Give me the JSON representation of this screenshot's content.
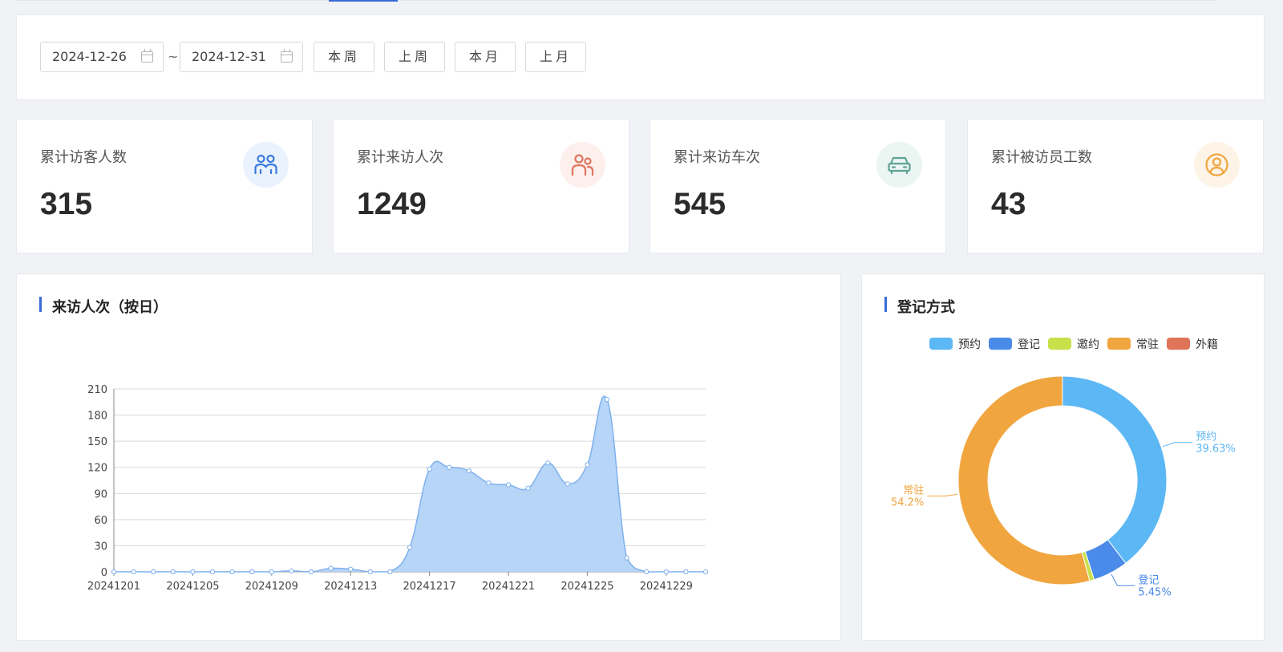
{
  "filter": {
    "start_date": "2024-12-26",
    "end_date": "2024-12-31",
    "separator": "~",
    "buttons": [
      "本周",
      "上周",
      "本月",
      "上月"
    ]
  },
  "stats": [
    {
      "label": "累计访客人数",
      "value": "315",
      "icon": "visitors-icon",
      "color": "#3a7bdc",
      "bg": "#eaf2fd"
    },
    {
      "label": "累计来访人次",
      "value": "1249",
      "icon": "users-icon",
      "color": "#e0745e",
      "bg": "#fcefec"
    },
    {
      "label": "累计来访车次",
      "value": "545",
      "icon": "car-icon",
      "color": "#5fa394",
      "bg": "#ebf5f2"
    },
    {
      "label": "累计被访员工数",
      "value": "43",
      "icon": "person-circle-icon",
      "color": "#f0a53e",
      "bg": "#fdf4e7"
    }
  ],
  "line_panel": {
    "title": "来访人次（按日）"
  },
  "pie_panel": {
    "title": "登记方式"
  },
  "chart_data": [
    {
      "type": "area",
      "title": "来访人次（按日）",
      "color": "#7eb0ee",
      "fill": "#b3d3f7",
      "ylim": [
        0,
        210
      ],
      "yticks": [
        0,
        30,
        60,
        90,
        120,
        150,
        180,
        210
      ],
      "xtick_labels": [
        "20241201",
        "20241205",
        "20241209",
        "20241213",
        "20241217",
        "20241221",
        "20241225",
        "20241229"
      ],
      "x": [
        "20241201",
        "20241202",
        "20241203",
        "20241204",
        "20241205",
        "20241206",
        "20241207",
        "20241208",
        "20241209",
        "20241210",
        "20241211",
        "20241212",
        "20241213",
        "20241214",
        "20241215",
        "20241216",
        "20241217",
        "20241218",
        "20241219",
        "20241220",
        "20241221",
        "20241222",
        "20241223",
        "20241224",
        "20241225",
        "20241226",
        "20241227",
        "20241228",
        "20241229",
        "20241230",
        "20241231"
      ],
      "values": [
        0,
        0,
        0,
        0,
        0,
        0,
        0,
        0,
        0,
        1,
        0,
        4,
        3,
        0,
        0,
        28,
        118,
        120,
        116,
        102,
        100,
        96,
        125,
        101,
        123,
        198,
        16,
        0,
        0,
        0,
        0
      ]
    },
    {
      "type": "pie",
      "title": "登记方式",
      "legend": [
        "预约",
        "登记",
        "邀约",
        "常驻",
        "外籍"
      ],
      "colors": [
        "#5cb7f5",
        "#4a8ae8",
        "#c8e04a",
        "#f0a53e",
        "#e07458"
      ],
      "values": [
        39.63,
        5.45,
        0.72,
        54.2,
        0
      ],
      "labels": [
        {
          "name": "预约",
          "pct": "39.63%"
        },
        {
          "name": "登记",
          "pct": "5.45%"
        },
        {
          "name": "常驻",
          "pct": "54.2%"
        }
      ]
    }
  ]
}
